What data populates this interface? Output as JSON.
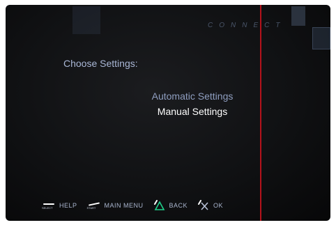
{
  "screen": {
    "header_title": "CONNECT"
  },
  "settings": {
    "heading": "Choose Settings:",
    "options": [
      {
        "label": "Automatic Settings",
        "selected": false
      },
      {
        "label": "Manual Settings",
        "selected": true
      }
    ]
  },
  "footer": {
    "select_cap": "SELECT",
    "start_cap": "START",
    "help_label": "HELP",
    "main_menu_label": "MAIN MENU",
    "back_label": "BACK",
    "ok_label": "OK"
  },
  "icons": {
    "select_button": "select-button-icon",
    "start_button": "start-button-icon",
    "back_button": "triangle-icon",
    "ok_button": "cross-icon"
  },
  "colors": {
    "background": "#101113",
    "selected_text": "#ffffff",
    "unselected_text": "#8f9ec0",
    "heading_text": "#a9b7d6",
    "accent_line": "#b3121b"
  }
}
